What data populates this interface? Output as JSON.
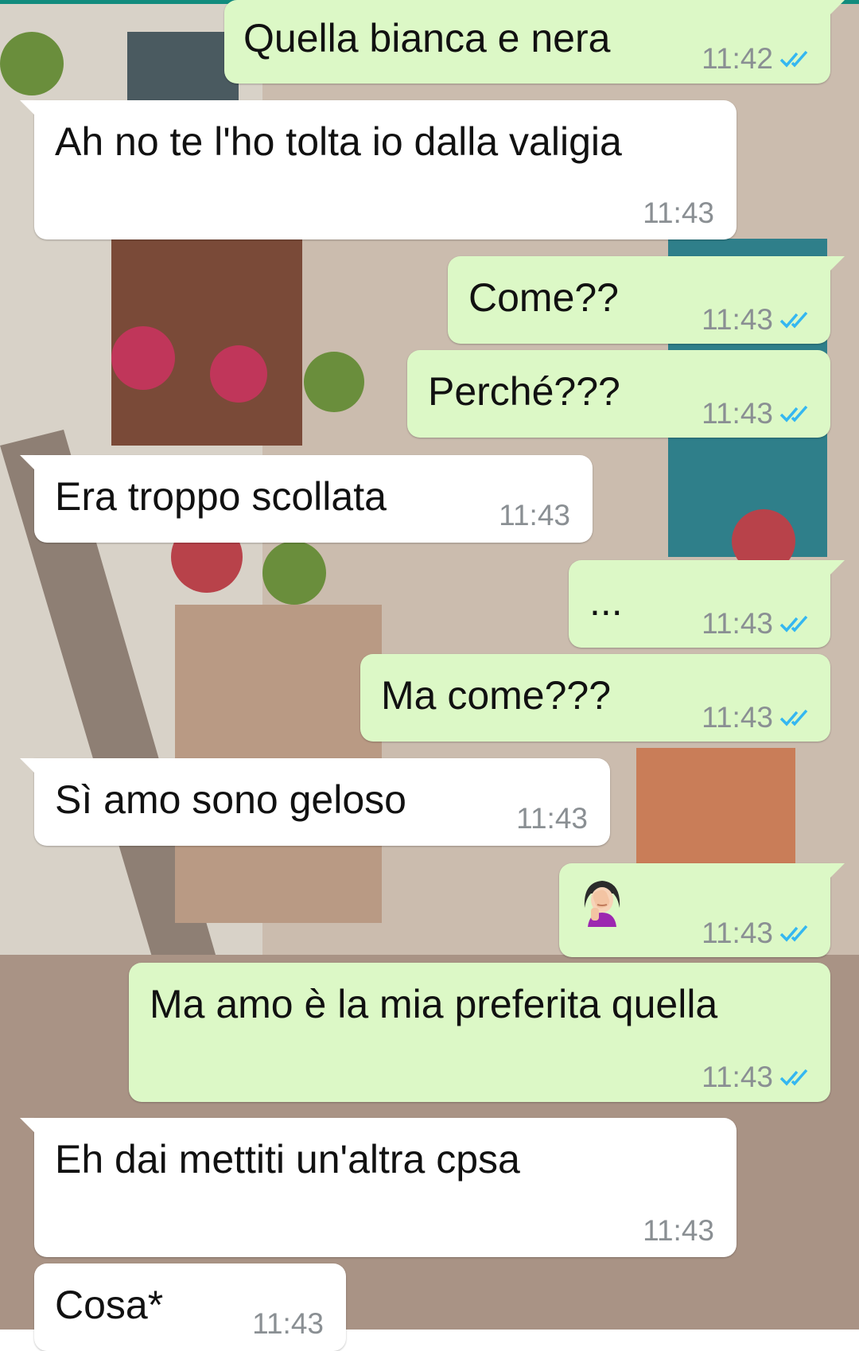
{
  "colors": {
    "outgoing_bubble": "#dcf8c6",
    "incoming_bubble": "#ffffff",
    "timestamp": "#8a8f93",
    "read_ticks": "#34b7f1",
    "header": "#128c7e"
  },
  "messages": [
    {
      "direction": "outgoing",
      "text": "Quella bianca e nera",
      "time": "11:42",
      "status": "read"
    },
    {
      "direction": "incoming",
      "text": "Ah no te l'ho tolta io dalla valigia",
      "time": "11:43"
    },
    {
      "direction": "outgoing",
      "text": "Come??",
      "time": "11:43",
      "status": "read"
    },
    {
      "direction": "outgoing",
      "text": "Perché???",
      "time": "11:43",
      "status": "read"
    },
    {
      "direction": "incoming",
      "text": "Era troppo scollata",
      "time": "11:43"
    },
    {
      "direction": "outgoing",
      "text": "...",
      "time": "11:43",
      "status": "read"
    },
    {
      "direction": "outgoing",
      "text": "Ma come???",
      "time": "11:43",
      "status": "read"
    },
    {
      "direction": "incoming",
      "text": "Sì amo sono geloso",
      "time": "11:43"
    },
    {
      "direction": "outgoing",
      "emoji": "woman-facepalming-icon",
      "time": "11:43",
      "status": "read"
    },
    {
      "direction": "outgoing",
      "text": "Ma amo è la mia preferita quella",
      "time": "11:43",
      "status": "read"
    },
    {
      "direction": "incoming",
      "text": "Eh dai mettiti un'altra cpsa",
      "time": "11:43"
    },
    {
      "direction": "incoming",
      "text": "Cosa*",
      "time": "11:43"
    }
  ]
}
